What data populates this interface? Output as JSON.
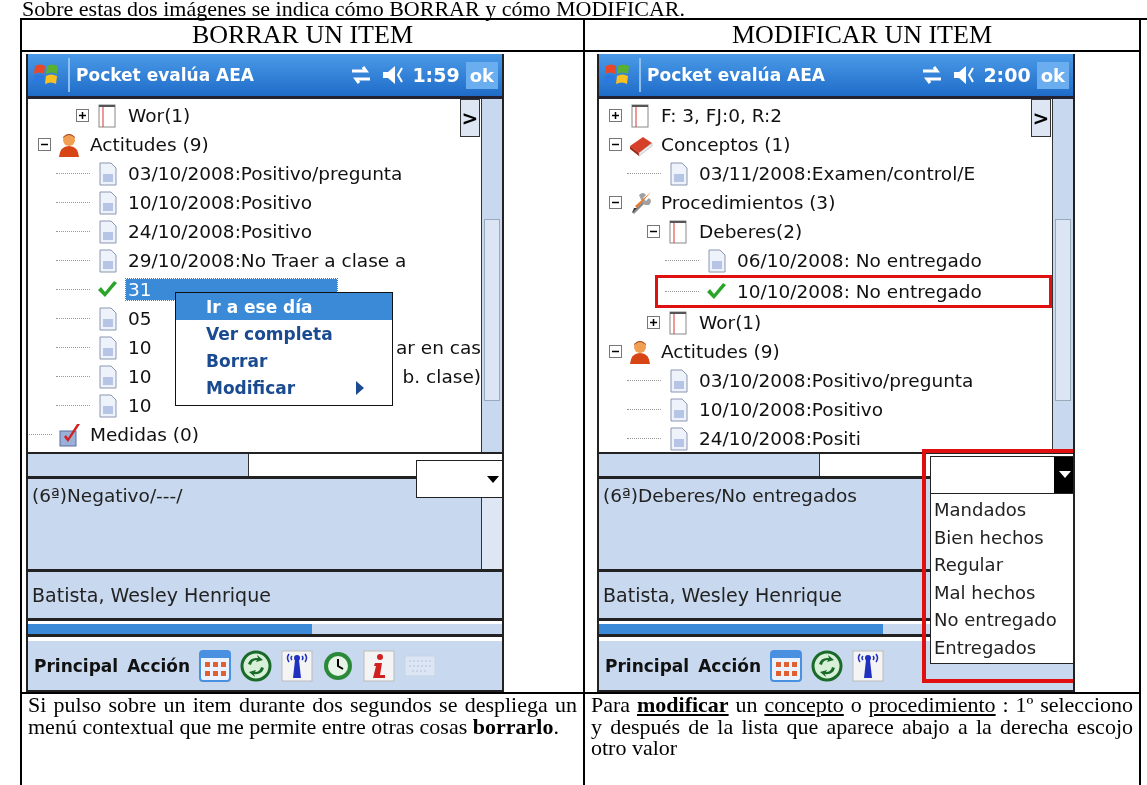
{
  "intro": "Sobre estas dos imágenes se indica cómo BORRAR y cómo MODIFICAR.",
  "panels": [
    {
      "heading": "BORRAR UN ITEM",
      "screen": {
        "title": "Pocket evalúa AEA",
        "time": "1:59",
        "ok": "ok",
        "more": ">",
        "tree": [
          {
            "children": [
              {
                "label": "Wor(1)",
                "kind": "notebook",
                "expanded": false
              }
            ]
          },
          {
            "label": "Actitudes (9)",
            "kind": "person",
            "expanded": true,
            "children": [
              {
                "label": "03/10/2008:Positivo/pregunta",
                "kind": "page",
                "selected": false
              },
              {
                "label": "10/10/2008:Positivo",
                "kind": "page",
                "selected": false
              },
              {
                "label": "24/10/2008:Positivo",
                "kind": "page",
                "selected": false
              },
              {
                "label": "29/10/2008:No Traer a clase a",
                "kind": "page",
                "selected": false
              },
              {
                "label": "31",
                "kind": "check",
                "selected": true
              },
              {
                "label": "05",
                "kind": "page",
                "selected": false
              },
              {
                "label": "10",
                "kind": "page",
                "selected": false,
                "tail": "ar en cas"
              },
              {
                "label": "10",
                "kind": "page",
                "selected": false,
                "tail": "b. clase)"
              },
              {
                "label": "10",
                "kind": "page",
                "selected": false
              }
            ]
          },
          {
            "label": "Medidas (0)",
            "kind": "measure"
          }
        ],
        "context_menu": [
          {
            "label": "Ir a ese día",
            "selected": true,
            "submenu": false
          },
          {
            "label": "Ver completa",
            "selected": false,
            "submenu": false
          },
          {
            "label": "Borrar",
            "selected": false,
            "submenu": false
          },
          {
            "label": "Modificar",
            "selected": false,
            "submenu": true
          }
        ],
        "dropdown": {
          "expanded": false
        },
        "detail": "(6ª)Negativo/---/",
        "student": "Batista, Wesley Henrique",
        "progress": {
          "level": 0.6
        },
        "toolbar": {
          "menus": [
            "Principal",
            "Acción"
          ],
          "icons": [
            {
              "kind": "calendar"
            },
            {
              "kind": "sync"
            },
            {
              "kind": "antenna"
            },
            {
              "kind": "clock"
            },
            {
              "kind": "info"
            },
            {
              "kind": "keyboard"
            }
          ]
        }
      },
      "caption": [
        {
          "text": "Si pulso sobre un item durante dos segundos se despliega un menú contextual que me permite entre otras cosas "
        },
        {
          "text": "borrarlo",
          "bold": true
        },
        {
          "text": "."
        }
      ]
    },
    {
      "heading": "MODIFICAR UN ITEM",
      "screen": {
        "title": "Pocket evalúa AEA",
        "time": "2:00",
        "ok": "ok",
        "more": ">",
        "tree": [
          {
            "label": "F: 3, FJ:0, R:2",
            "kind": "notebook",
            "expanded": false
          },
          {
            "label": "Conceptos (1)",
            "kind": "book",
            "expanded": true,
            "children": [
              {
                "label": "03/11/2008:Examen/control/E",
                "kind": "page"
              }
            ]
          },
          {
            "label": "Procedimientos (3)",
            "kind": "tools",
            "expanded": true,
            "children": [
              {
                "label": "Deberes(2)",
                "kind": "notebook",
                "expanded": true,
                "children": [
                  {
                    "label": "06/10/2008: No entregado",
                    "kind": "page",
                    "annotated": false
                  },
                  {
                    "label": "10/10/2008: No entregado",
                    "kind": "check",
                    "annotated": true
                  }
                ]
              },
              {
                "label": "Wor(1)",
                "kind": "notebook",
                "expanded": false
              }
            ]
          },
          {
            "label": "Actitudes (9)",
            "kind": "person",
            "expanded": true,
            "children": [
              {
                "label": "03/10/2008:Positivo/pregunta",
                "kind": "page"
              },
              {
                "label": "10/10/2008:Positivo",
                "kind": "page"
              },
              {
                "label": "24/10/2008:Positi",
                "kind": "page"
              }
            ]
          }
        ],
        "dropdown": {
          "expanded": true,
          "annotated": true,
          "options": [
            "Mandados",
            "Bien hechos",
            "Regular",
            "Mal hechos",
            "No entregado",
            "Entregados"
          ]
        },
        "detail": "(6ª)Deberes/No entregados",
        "student": "Batista, Wesley Henrique",
        "progress": {
          "level": 0.6
        },
        "toolbar": {
          "menus": [
            "Principal",
            "Acción"
          ],
          "icons": [
            {
              "kind": "calendar"
            },
            {
              "kind": "sync"
            },
            {
              "kind": "antenna"
            }
          ]
        }
      },
      "caption": [
        {
          "text": "Para "
        },
        {
          "text": "modificar",
          "bold": true,
          "underline": true
        },
        {
          "text": " un "
        },
        {
          "text": "concepto",
          "underline": true
        },
        {
          "text": " o "
        },
        {
          "text": "procedimiento",
          "underline": true
        },
        {
          "text": " : 1º selecciono y después de la lista que aparece abajo a la derecha escojo otro valor"
        }
      ]
    }
  ]
}
